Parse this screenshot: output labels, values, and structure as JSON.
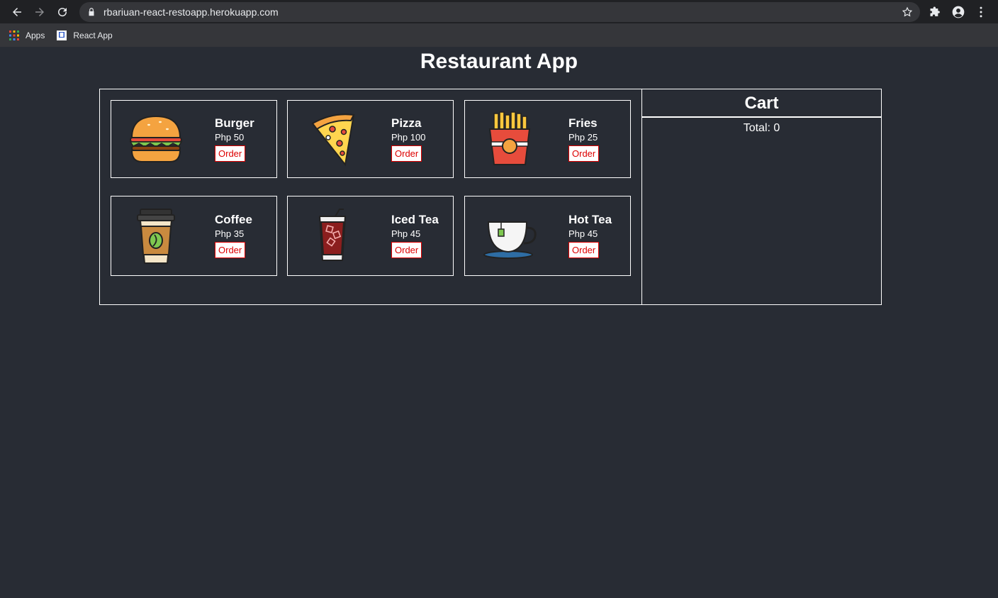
{
  "browser": {
    "url": "rbariuan-react-restoapp.herokuapp.com",
    "bookmarks": [
      {
        "label": "Apps"
      },
      {
        "label": "React App"
      }
    ]
  },
  "page": {
    "title": "Restaurant App"
  },
  "menu": {
    "items": [
      {
        "name": "Burger",
        "price": "Php 50",
        "order_label": "Order",
        "icon": "burger-icon"
      },
      {
        "name": "Pizza",
        "price": "Php 100",
        "order_label": "Order",
        "icon": "pizza-icon"
      },
      {
        "name": "Fries",
        "price": "Php 25",
        "order_label": "Order",
        "icon": "fries-icon"
      },
      {
        "name": "Coffee",
        "price": "Php 35",
        "order_label": "Order",
        "icon": "coffee-icon"
      },
      {
        "name": "Iced Tea",
        "price": "Php 45",
        "order_label": "Order",
        "icon": "iced-tea-icon"
      },
      {
        "name": "Hot Tea",
        "price": "Php 45",
        "order_label": "Order",
        "icon": "hot-tea-icon"
      }
    ]
  },
  "cart": {
    "title": "Cart",
    "total": "Total: 0"
  },
  "colors": {
    "background": "#282c34",
    "order_button_text": "#dd0000"
  }
}
